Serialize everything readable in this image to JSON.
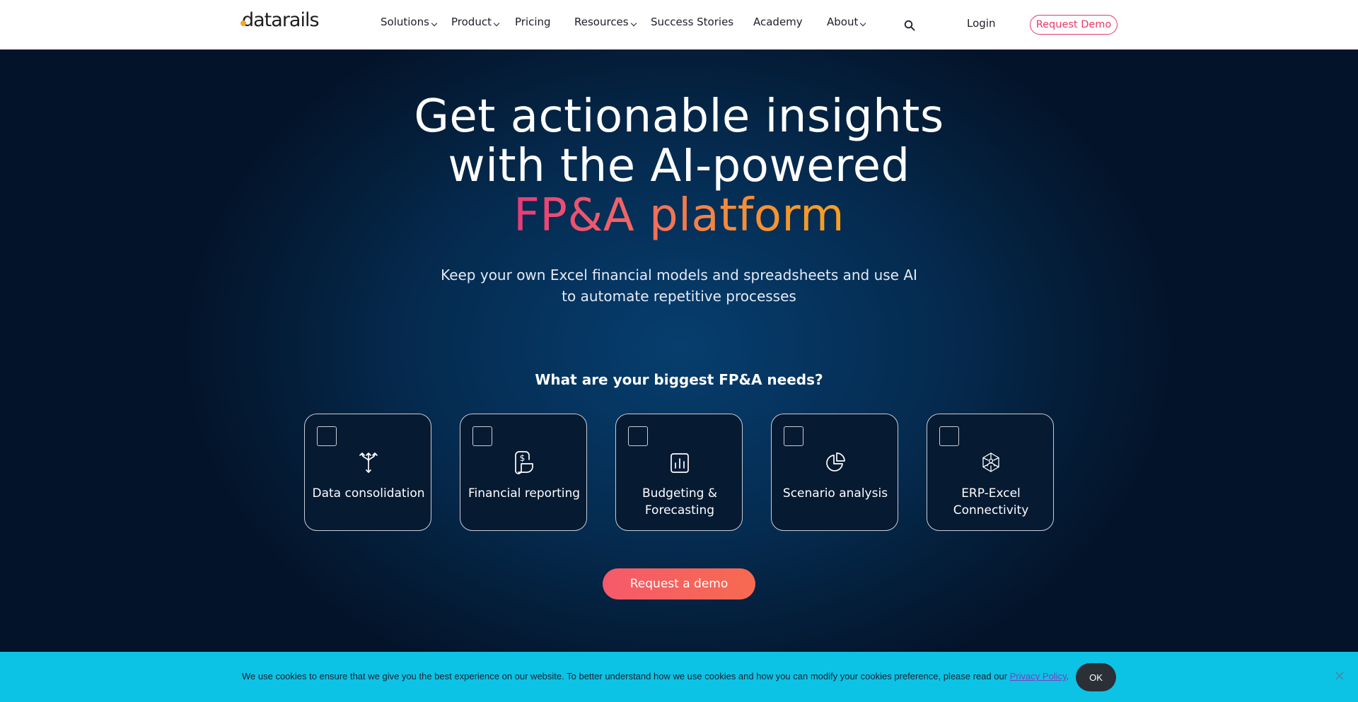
{
  "header": {
    "logo": "datarails",
    "nav": [
      {
        "label": "Solutions",
        "dropdown": true
      },
      {
        "label": "Product",
        "dropdown": true
      },
      {
        "label": "Pricing",
        "dropdown": false
      },
      {
        "label": "Resources",
        "dropdown": true
      },
      {
        "label": "Success Stories",
        "dropdown": false
      },
      {
        "label": "Academy",
        "dropdown": false
      },
      {
        "label": "About",
        "dropdown": true
      }
    ],
    "login_label": "Login",
    "request_demo_label": "Request Demo"
  },
  "hero": {
    "headline_line1": "Get actionable insights",
    "headline_line2": "with the AI-powered",
    "headline_highlight": "FP&A platform",
    "subtitle_line1": "Keep your own Excel financial models and spreadsheets and use AI",
    "subtitle_line2": "to automate repetitive processes",
    "needs_question": "What are your biggest FP&A needs?",
    "needs": [
      {
        "label": "Data consolidation",
        "icon": "merge-arrows-icon",
        "checked": false
      },
      {
        "label": "Financial reporting",
        "icon": "dollar-report-icon",
        "checked": false
      },
      {
        "label": "Budgeting & Forecasting",
        "icon": "bar-chart-icon",
        "checked": false
      },
      {
        "label": "Scenario analysis",
        "icon": "pie-chart-icon",
        "checked": false
      },
      {
        "label": "ERP-Excel Connectivity",
        "icon": "network-icon",
        "checked": false
      }
    ],
    "cta_label": "Request a demo"
  },
  "cookie_banner": {
    "text": "We use cookies to ensure that we give you the best experience on our website. To better understand how we use cookies and how you can modify your cookies preference, please read our",
    "link_label": "Privacy Policy",
    "after_link": ".",
    "ok_label": "OK"
  },
  "colors": {
    "accent": "#e6386b",
    "cta": "#f55a6a",
    "cookie_bar": "#0dc3e5",
    "hero_bg": "#052a4e"
  }
}
